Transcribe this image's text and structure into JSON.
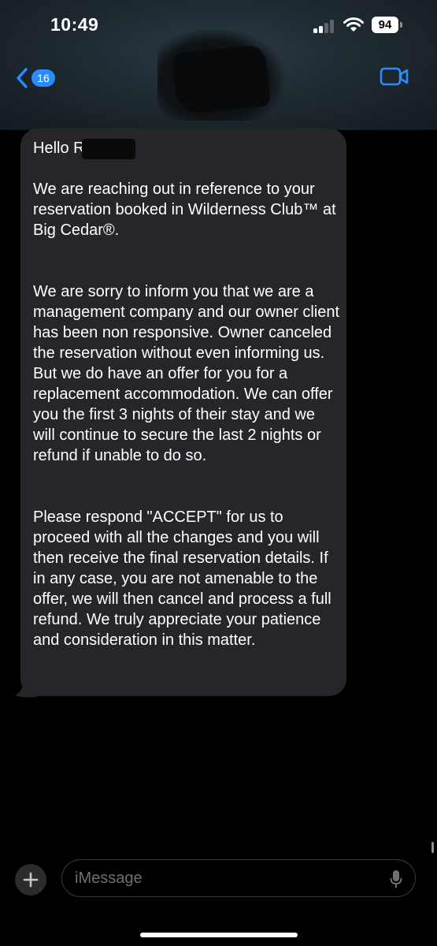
{
  "status_bar": {
    "time": "10:49",
    "battery": "94"
  },
  "header": {
    "back_badge": "16",
    "accent_color": "#2a8cff"
  },
  "message": {
    "greeting": "Hello Ro",
    "paragraphs": [
      "We are reaching out in reference to your reservation booked in Wilderness Club™ at Big Cedar®.",
      "We are sorry to inform you that we are a management company and our owner client has been non responsive. Owner canceled the reservation without even informing us. But we do have an offer for you for a replacement accommodation. We can offer you the first 3 nights of their stay and we will continue to secure the last 2 nights or refund if unable to do so.",
      "Please respond \"ACCEPT\" for us to proceed with all the changes and you will then receive the final reservation details. If in any case, you are not amenable to the offer, we will then cancel and process a full refund. We truly appreciate your patience and consideration in this matter."
    ]
  },
  "composer": {
    "placeholder": "iMessage"
  },
  "icons": {
    "back": "chevron-left-icon",
    "video": "video-camera-icon",
    "add": "plus-icon",
    "mic": "microphone-icon",
    "wifi": "wifi-icon",
    "signal": "cellular-signal-icon"
  }
}
